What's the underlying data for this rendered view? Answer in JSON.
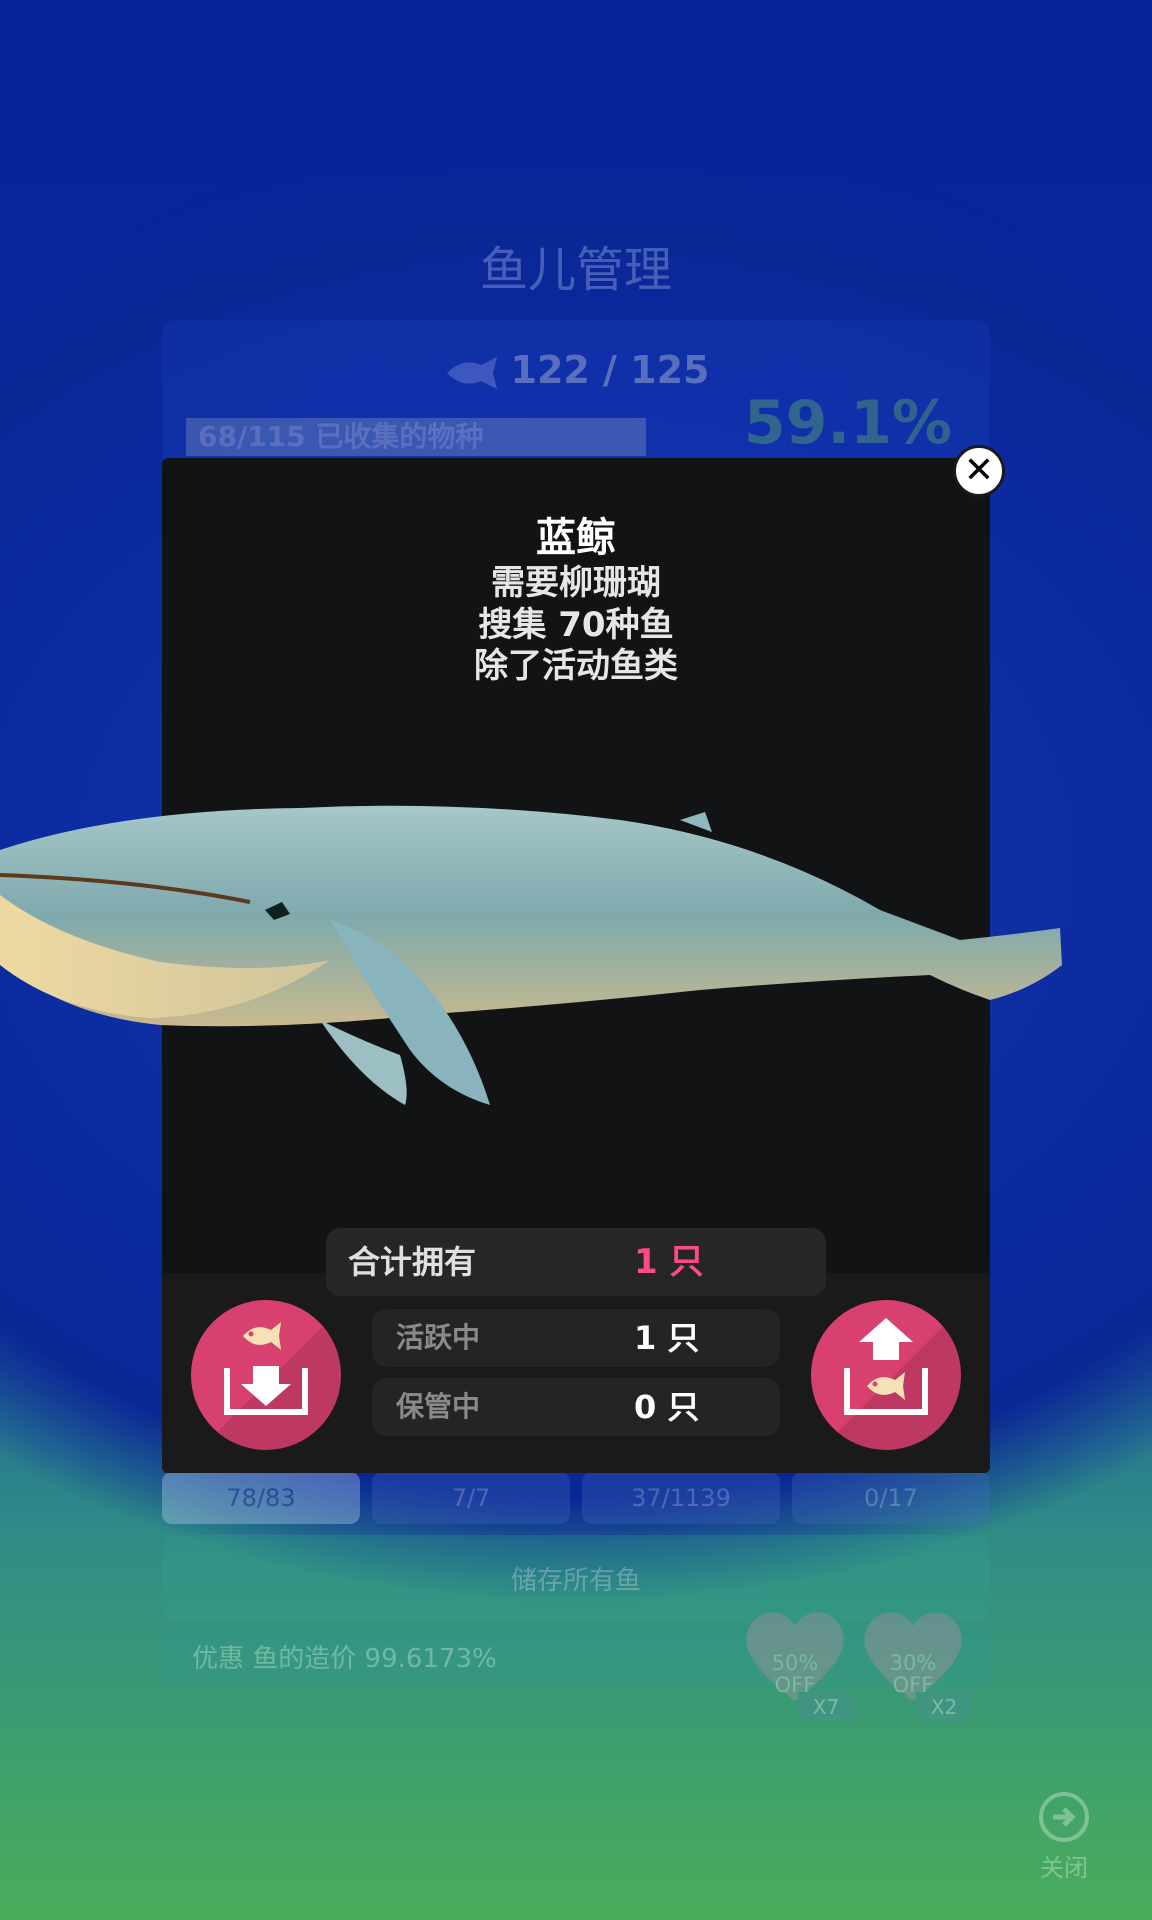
{
  "background": {
    "title": "鱼儿管理",
    "fish_total": "122 / 125",
    "species_collected": "68/115 已收集的物种",
    "completion_percent": "59.1%",
    "tabs": [
      "78/83",
      "7/7",
      "37/1139",
      "0/17"
    ],
    "store_all_label": "储存所有鱼",
    "discount_text": "优惠 鱼的造价 99.6173%",
    "coupons": [
      {
        "line1": "50%",
        "line2": "OFF",
        "multiplier": "X7"
      },
      {
        "line1": "30%",
        "line2": "OFF",
        "multiplier": "X2"
      }
    ],
    "close_label": "关闭"
  },
  "modal": {
    "close_icon_text": "✕",
    "fish_name": "蓝鲸",
    "requirements": [
      "需要柳珊瑚",
      "搜集 70种鱼",
      "除了活动鱼类"
    ],
    "total_label": "合计拥有",
    "total_value": "1 只",
    "active_label": "活跃中",
    "active_value": "1 只",
    "stored_label": "保管中",
    "stored_value": "0 只",
    "store_button_icon": "fish-store-icon",
    "release_button_icon": "fish-release-icon"
  },
  "colors": {
    "accent_pink": "#d8416f",
    "total_value": "#ff4a8a",
    "percent_green": "#7fe26b"
  }
}
